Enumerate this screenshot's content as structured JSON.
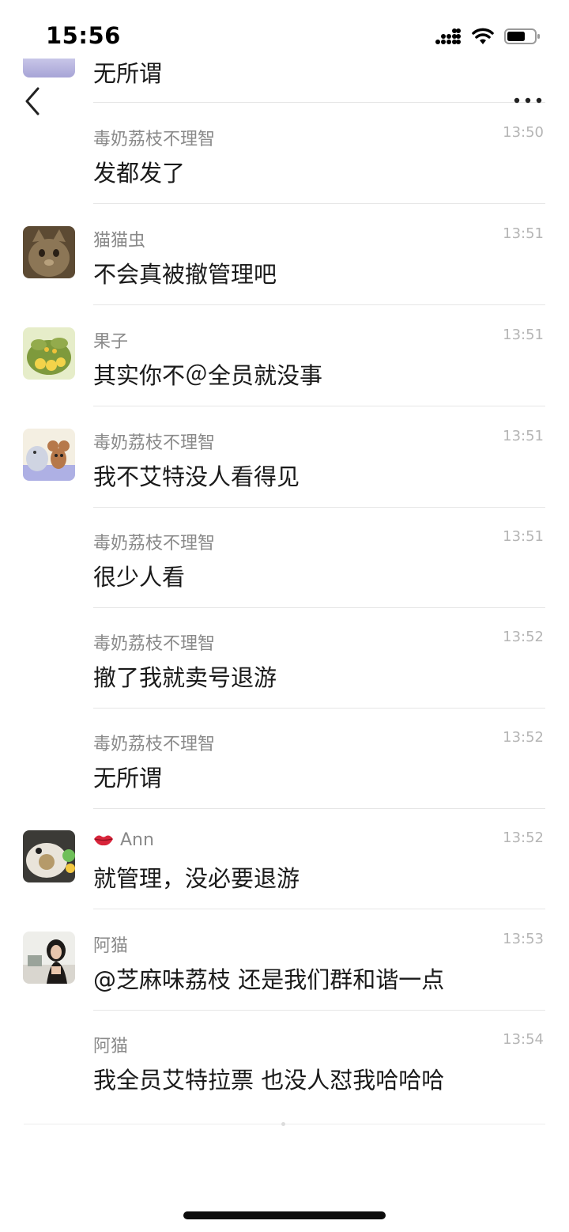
{
  "status_bar": {
    "time": "15:56"
  },
  "top_partial": {
    "text": "无所谓"
  },
  "messages": [
    {
      "sender": "毒奶荔枝不理智",
      "time": "13:50",
      "text": "发都发了",
      "avatar": "none"
    },
    {
      "sender": "猫猫虫",
      "time": "13:51",
      "text": "不会真被撤管理吧",
      "avatar": "cat-photo"
    },
    {
      "sender": "果子",
      "time": "13:51",
      "text": "其实你不＠全员就没事",
      "avatar": "chicks-illustration"
    },
    {
      "sender": "毒奶荔枝不理智",
      "time": "13:51",
      "text": "我不艾特没人看得见",
      "avatar": "tom-and-jerry"
    },
    {
      "sender": "毒奶荔枝不理智",
      "time": "13:51",
      "text": "很少人看",
      "avatar": "none"
    },
    {
      "sender": "毒奶荔枝不理智",
      "time": "13:52",
      "text": "撤了我就卖号退游",
      "avatar": "none"
    },
    {
      "sender": "毒奶荔枝不理智",
      "time": "13:52",
      "text": "无所谓",
      "avatar": "none"
    },
    {
      "sender": "Ann",
      "time": "13:52",
      "text": "就管理，没必要退游",
      "avatar": "food-photo",
      "name_icon": "lips-icon"
    },
    {
      "sender": "阿猫",
      "time": "13:53",
      "text": "@芝麻味荔枝 还是我们群和谐一点",
      "avatar": "girl-photo"
    },
    {
      "sender": "阿猫",
      "time": "13:54",
      "text": "我全员艾特拉票 也没人怼我哈哈哈",
      "avatar": "none"
    }
  ],
  "colors": {
    "name": "#8a8a8a",
    "time": "#b5b5b5",
    "divider": "#e6e6e6"
  }
}
